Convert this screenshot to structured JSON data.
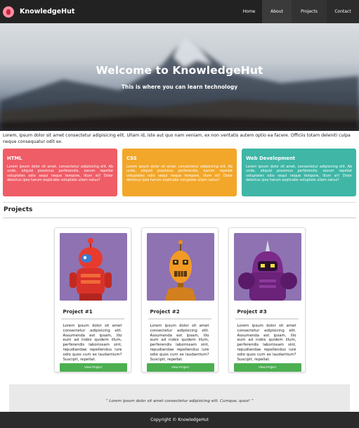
{
  "brand": {
    "name": "KnowledgeHut"
  },
  "nav": {
    "items": [
      "Home",
      "About",
      "Projects",
      "Contact"
    ]
  },
  "hero": {
    "title": "Welcome to KnowledgeHut",
    "subtitle": "This is where you can learn technology"
  },
  "intro": "Lorem, ipsum dolor sit amet consectetur adipisicing elit. Ullam id, iste aut quo nam veniam, ex non veritatis autem optio ea facere. Officiis totam deleniti culpa neque consequatur odit ex.",
  "features": [
    {
      "title": "HTML",
      "text": "Lorem ipsum dolor sit amet, consectetur adipisicing elit. Ab unde, aliquid possimus perferendis, earum repellat voluptates odio sequi neque tempore, illum sit! Dolor delectus ipsa harum explicabo voluptate ullam natus?",
      "color": "#ef5d67"
    },
    {
      "title": "CSS",
      "text": "Lorem ipsum dolor sit amet, consectetur adipisicing elit. Ab unde, aliquid possimus perferendis, earum repellat voluptates odio sequi neque tempore, illum sit! Dolor delectus ipsa harum explicabo voluptate ullam natus?",
      "color": "#f2a72a"
    },
    {
      "title": "Web Development",
      "text": "Lorem ipsum dolor sit amet, consectetur adipisicing elit. Ab unde, aliquid possimus perferendis, earum repellat voluptates odio sequi neque tempore, illum sit! Dolor delectus ipsa harum explicabo voluptate ullam natus?",
      "color": "#3fb6a6"
    }
  ],
  "projects": {
    "heading": "Projects",
    "items": [
      {
        "title": "Project #1",
        "text": "Lorem ipsum dolor sit amet consectetur adipisicing elit. Assumenda est ipsam, illo eum ad nobis quidem illum, perferendis laboriosam sint, repudiandae repellendus iure odio quos cum ex laudantium? Suscipit, repellat.",
        "button": "View Project",
        "robot": "red-robot"
      },
      {
        "title": "Project #2",
        "text": "Lorem ipsum dolor sit amet consectetur adipisicing elit. Assumenda est ipsam, illo eum ad nobis quidem illum, perferendis laboriosam sint, repudiandae repellendus iure odio quos cum ex laudantium? Suscipit, repellat.",
        "button": "View Project",
        "robot": "orange-robot"
      },
      {
        "title": "Project #3",
        "text": "Lorem ipsum dolor sit amet consectetur adipisicing elit. Assumenda est ipsam, illo eum ad nobis quidem illum, perferendis laboriosam sint, repudiandae repellendus iure odio quos cum ex laudantium? Suscipit, repellat.",
        "button": "View Project",
        "robot": "purple-robot"
      }
    ]
  },
  "quote": "“ Lorem ipsum dolor sit amet consectetur adipisicing elit. Cumque, quos! ”",
  "footer": {
    "text": "Copyright © KnowledgeHut"
  }
}
